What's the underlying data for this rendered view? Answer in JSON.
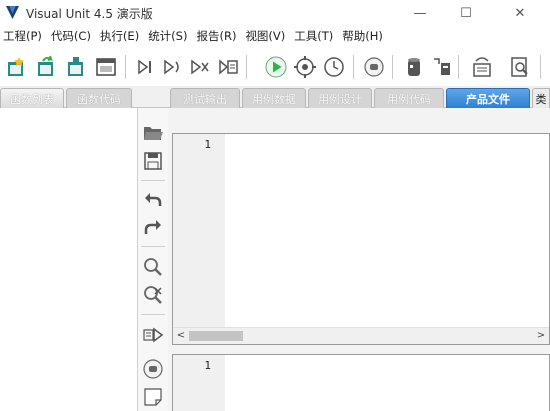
{
  "window": {
    "title": "Visual Unit 4.5 演示版",
    "minimize_glyph": "—",
    "maximize_glyph": "☐",
    "close_glyph": "✕"
  },
  "menu": {
    "items": [
      {
        "label": "工程(P)"
      },
      {
        "label": "代码(C)"
      },
      {
        "label": "执行(E)"
      },
      {
        "label": "统计(S)"
      },
      {
        "label": "报告(R)"
      },
      {
        "label": "视图(V)"
      },
      {
        "label": "工具(T)"
      },
      {
        "label": "帮助(H)"
      }
    ]
  },
  "toolbar": {
    "buttons": [
      {
        "icon": "new-project-icon"
      },
      {
        "icon": "open-project-icon"
      },
      {
        "icon": "save-project-icon"
      },
      {
        "icon": "window-icon"
      },
      {
        "icon": "step-icon"
      },
      {
        "icon": "step-into-icon"
      },
      {
        "icon": "step-over-icon"
      },
      {
        "icon": "breakpoint-icon"
      },
      {
        "icon": "run-icon"
      },
      {
        "icon": "gear-run-icon"
      },
      {
        "icon": "clock-icon"
      },
      {
        "icon": "stop-icon"
      },
      {
        "icon": "database-icon"
      },
      {
        "icon": "tag-icon"
      },
      {
        "icon": "report-icon"
      },
      {
        "icon": "find-icon"
      }
    ]
  },
  "tabs": {
    "left": [
      {
        "label": "函数列表"
      },
      {
        "label": "函数代码"
      }
    ],
    "right": [
      {
        "label": "测试输出"
      },
      {
        "label": "用例数据"
      },
      {
        "label": "用例设计"
      },
      {
        "label": "用例代码"
      },
      {
        "label": "产品文件"
      },
      {
        "label": "类"
      }
    ],
    "active": "产品文件"
  },
  "sidetools": [
    {
      "icon": "folder-open-icon"
    },
    {
      "icon": "save-disk-icon"
    },
    {
      "icon": "undo-icon"
    },
    {
      "icon": "redo-icon"
    },
    {
      "icon": "zoom-icon"
    },
    {
      "icon": "zoom-clear-icon"
    },
    {
      "icon": "run-to-line-icon"
    },
    {
      "icon": "stop-circle-icon"
    },
    {
      "icon": "note-icon"
    }
  ],
  "editor_top": {
    "line_number": "1",
    "scroll_left": "<",
    "scroll_right": ">"
  },
  "editor_bottom": {
    "line_number": "1"
  },
  "colors": {
    "active_tab": "#3b8ade",
    "run_green": "#2fb24a",
    "icon_teal": "#2a8a88"
  }
}
